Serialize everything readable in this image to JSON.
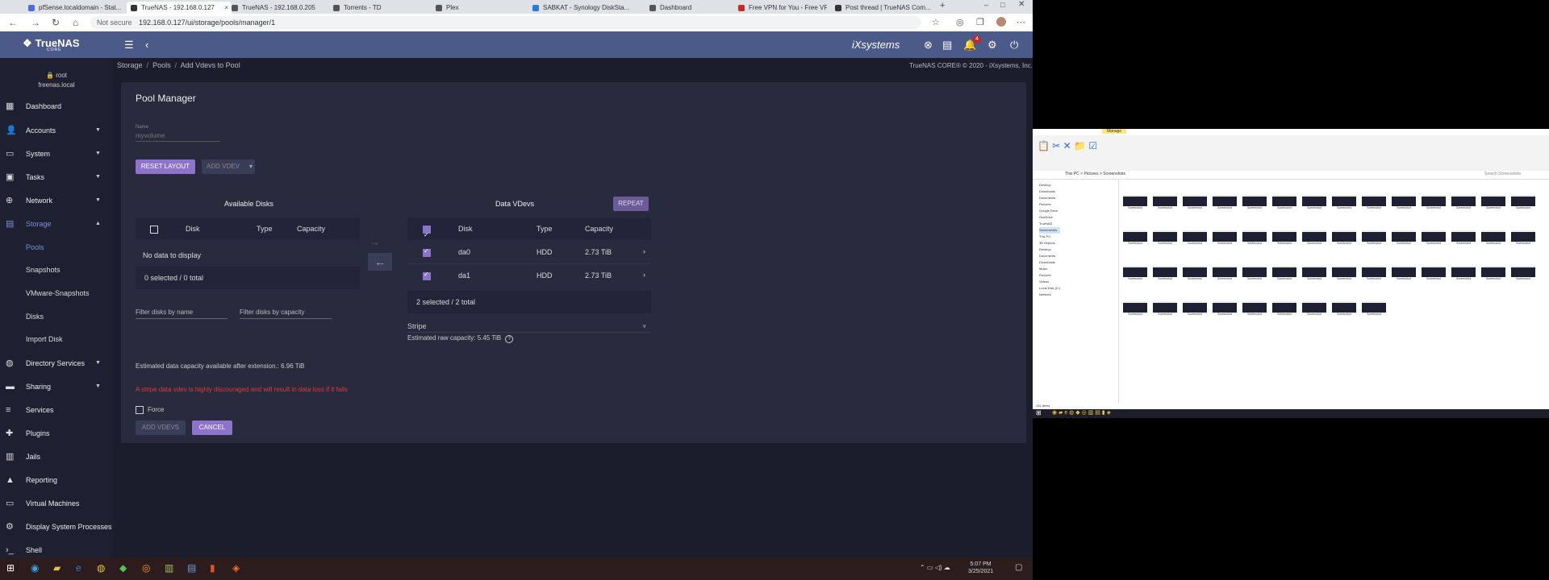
{
  "browser": {
    "tabs": [
      {
        "label": "pfSense.localdomain - Stat...",
        "color": "#4f6bd6",
        "active": false
      },
      {
        "label": "TrueNAS - 192.168.0.127",
        "color": "#333",
        "active": true
      },
      {
        "label": "TrueNAS - 192.168.0.205",
        "color": "#555",
        "active": false
      },
      {
        "label": "Torrents - TD",
        "color": "#555",
        "active": false
      },
      {
        "label": "Plex",
        "color": "#555",
        "active": false
      },
      {
        "label": "SABKAT - Synology DiskSta...",
        "color": "#2b7bd6",
        "active": false
      },
      {
        "label": "Dashboard",
        "color": "#555",
        "active": false
      },
      {
        "label": "Free VPN for You - Free VP...",
        "color": "#c62828",
        "active": false
      },
      {
        "label": "Post thread | TrueNAS Com...",
        "color": "#333",
        "active": false
      }
    ],
    "url_security": "Not secure",
    "url": "192.168.0.127/ui/storage/pools/manager/1"
  },
  "header": {
    "logo_text": "TrueNAS",
    "logo_sub": "CORE",
    "vendor": "iXsystems",
    "notification_count": "4"
  },
  "sidebar": {
    "user": "root",
    "host": "freenas.local",
    "items": [
      {
        "label": "Dashboard",
        "icon": "dashboard-icon"
      },
      {
        "label": "Accounts",
        "icon": "accounts-icon"
      },
      {
        "label": "System",
        "icon": "system-icon"
      },
      {
        "label": "Tasks",
        "icon": "tasks-icon"
      },
      {
        "label": "Network",
        "icon": "network-icon"
      },
      {
        "label": "Storage",
        "icon": "storage-icon"
      },
      {
        "label": "Pools"
      },
      {
        "label": "Snapshots"
      },
      {
        "label": "VMware-Snapshots"
      },
      {
        "label": "Disks"
      },
      {
        "label": "Import Disk"
      },
      {
        "label": "Directory Services",
        "icon": "directory-icon"
      },
      {
        "label": "Sharing",
        "icon": "sharing-icon"
      },
      {
        "label": "Services",
        "icon": "services-icon"
      },
      {
        "label": "Plugins",
        "icon": "plugins-icon"
      },
      {
        "label": "Jails",
        "icon": "jails-icon"
      },
      {
        "label": "Reporting",
        "icon": "reporting-icon"
      },
      {
        "label": "Virtual Machines",
        "icon": "vm-icon"
      },
      {
        "label": "Display System Processes",
        "icon": "processes-icon"
      },
      {
        "label": "Shell",
        "icon": "shell-icon"
      }
    ]
  },
  "breadcrumb": {
    "storage": "Storage",
    "pools": "Pools",
    "current": "Add Vdevs to Pool"
  },
  "copyright": "TrueNAS CORE® © 2020 - iXsystems, Inc.",
  "pool_manager": {
    "title": "Pool Manager",
    "name_label": "Name",
    "name_value": "myvolume",
    "reset_layout": "RESET LAYOUT",
    "add_vdev": "ADD VDEV",
    "available_title": "Available Disks",
    "data_title": "Data VDevs",
    "repeat": "REPEAT",
    "col_disk": "Disk",
    "col_type": "Type",
    "col_capacity": "Capacity",
    "no_data": "No data to display",
    "available_count": "0 selected / 0 total",
    "data_rows": [
      {
        "disk": "da0",
        "type": "HDD",
        "capacity": "2.73 TiB"
      },
      {
        "disk": "da1",
        "type": "HDD",
        "capacity": "2.73 TiB"
      }
    ],
    "data_count": "2 selected / 2 total",
    "filter_name": "Filter disks by name",
    "filter_capacity": "Filter disks by capacity",
    "layout": "Stripe",
    "raw_capacity": "Estimated raw capacity: 5.45 TiB",
    "estimated": "Estimated data capacity available after extension.: 6.96 TiB",
    "warning": "A stripe data vdev is highly discouraged and will result in data loss if it fails",
    "force": "Force",
    "add_vdevs": "ADD VDEVS",
    "cancel": "CANCEL"
  },
  "taskbar": {
    "time": "5:07 PM",
    "date": "3/25/2021"
  },
  "explorer": {
    "ribbon_title": "Manage",
    "path": "This PC > Pictures > Screenshots",
    "search": "Search Screenshots",
    "tree": [
      "Desktop",
      "Downloads",
      "Documents",
      "Pictures",
      "Google Drive",
      "OneDrive",
      "TrueNAS",
      "Screenshots",
      "This PC",
      "3D Objects",
      "Desktop",
      "Documents",
      "Downloads",
      "Music",
      "Pictures",
      "Videos",
      "Local Disk (C:)",
      "Network"
    ],
    "status": "131 items",
    "thumb_label": "Screenshot"
  }
}
